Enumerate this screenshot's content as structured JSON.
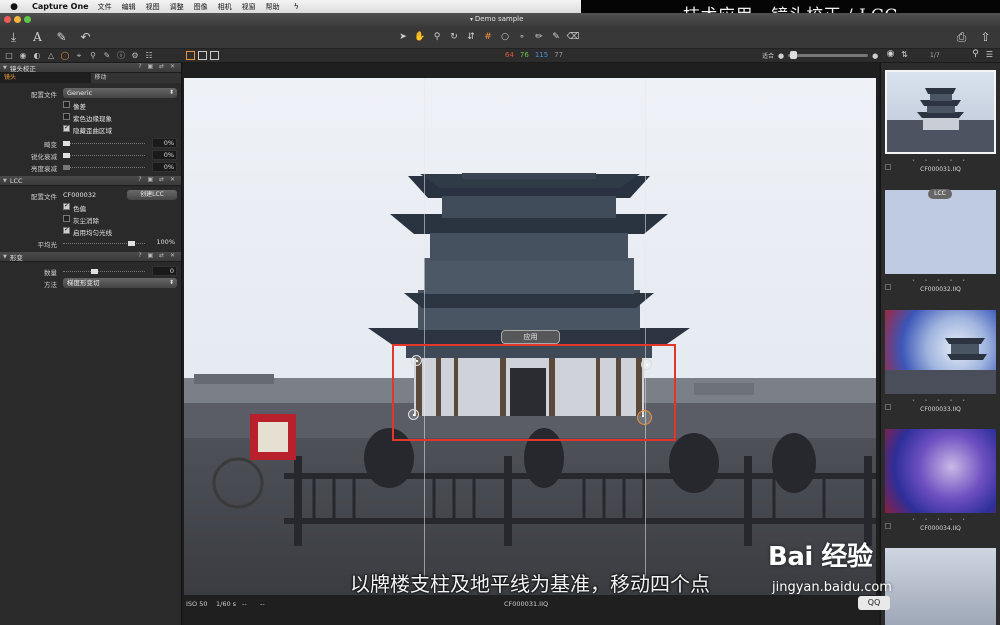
{
  "menubar": {
    "app_name": "Capture One",
    "items": [
      "文件",
      "编辑",
      "视图",
      "调整",
      "图像",
      "相机",
      "视窗",
      "帮助"
    ]
  },
  "caption_banner": "技术应用 - 镜头校正 / LCC",
  "window": {
    "title": "Demo sample"
  },
  "levels": {
    "values": [
      "64",
      "76",
      "115",
      "77"
    ],
    "colors": [
      "#e05a3a",
      "#6cc04a",
      "#4a8ee0",
      "#9a9a9a"
    ]
  },
  "toolbar": {
    "icons": [
      "import-icon",
      "text-icon",
      "brush-icon",
      "undo-icon"
    ],
    "cursor_tools": [
      "select-icon",
      "pan-icon",
      "zoom-icon",
      "rotate-icon",
      "straighten-icon",
      "keystone-icon",
      "crop-icon",
      "spot-icon",
      "picker-icon",
      "brush-icon",
      "erase-icon"
    ],
    "active_cursor_index": 6
  },
  "subbar": {
    "zoom_label": "适合",
    "browser_count": "1/7"
  },
  "lens_panel": {
    "title": "镜头校正",
    "tabs": [
      "镜头",
      "移动"
    ],
    "profile_label": "配置文件",
    "profile_value": "Generic",
    "checks": [
      {
        "label": "像差",
        "checked": false
      },
      {
        "label": "紫色边缘现象",
        "checked": false
      },
      {
        "label": "隐藏歪曲区域",
        "checked": true
      }
    ],
    "sliders": [
      {
        "label": "畸变",
        "value": "0%",
        "position": 0.0
      },
      {
        "label": "锐化衰减",
        "value": "0%",
        "position": 0.0
      },
      {
        "label": "亮度衰减",
        "value": "0%",
        "position": 0.0
      }
    ]
  },
  "lcc_panel": {
    "title": "LCC",
    "profile_label": "配置文件",
    "profile_value": "CF000032",
    "create_button": "创建LCC",
    "checks": [
      {
        "label": "色偏",
        "checked": true
      },
      {
        "label": "灰尘消除",
        "checked": false
      },
      {
        "label": "启用均匀光线",
        "checked": true
      }
    ],
    "uniform_label": "平均光",
    "uniform_value": "100%",
    "uniform_position": 1.0
  },
  "keystone_panel": {
    "title": "形变",
    "amount_label": "数量",
    "amount_value": "0",
    "amount_position": 0.5,
    "method_label": "方法",
    "method_value": "梯度形变切"
  },
  "viewer": {
    "apply_button": "应用",
    "subtitle": "以牌楼支柱及地平线为基准，移动四个点",
    "iso": "ISO 50",
    "shutter": "1/60 s",
    "dash1": "--",
    "dash2": "--",
    "filename": "CF000031.IIQ"
  },
  "browser": {
    "lcc_badge": "LCC",
    "thumbs": [
      {
        "name": "CF000031.IIQ",
        "selected": true
      },
      {
        "name": "CF000032.IIQ",
        "selected": false
      },
      {
        "name": "CF000033.IIQ",
        "selected": false
      },
      {
        "name": "CF000034.IIQ",
        "selected": false
      }
    ],
    "stars": "• • • • •"
  },
  "watermark": {
    "brand": "Bai 经验",
    "url": "jingyan.baidu.com",
    "qq": "QQ"
  }
}
